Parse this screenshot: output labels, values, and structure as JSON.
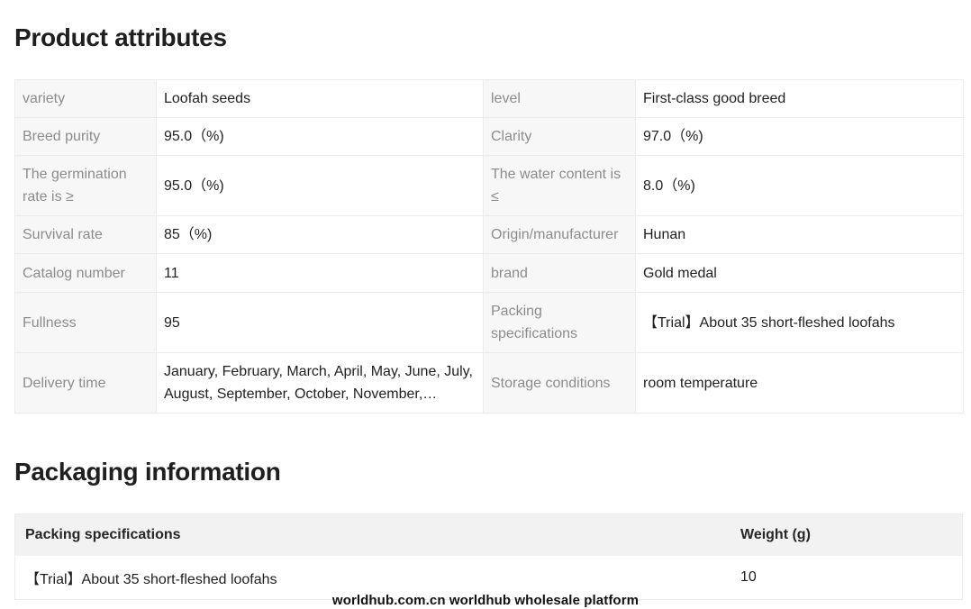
{
  "attributes": {
    "title": "Product attributes",
    "rows": [
      {
        "k1": "variety",
        "v1": "Loofah seeds",
        "k2": "level",
        "v2": "First-class good breed"
      },
      {
        "k1": "Breed purity",
        "v1": "95.0（%)",
        "k2": "Clarity",
        "v2": "97.0（%)"
      },
      {
        "k1": "The germination rate is ≥",
        "v1": "95.0（%)",
        "k2": "The water content is ≤",
        "v2": "8.0（%)"
      },
      {
        "k1": "Survival rate",
        "v1": "85（%)",
        "k2": "Origin/manufacturer",
        "v2": "Hunan"
      },
      {
        "k1": "Catalog number",
        "v1": "11",
        "k2": "brand",
        "v2": "Gold medal"
      },
      {
        "k1": "Fullness",
        "v1": "95",
        "k2": "Packing specifications",
        "v2": "【Trial】About 35 short-fleshed loofahs"
      },
      {
        "k1": "Delivery time",
        "v1": "January, February, March, April, May, June, July, August, September, October, November, December",
        "k2": "Storage conditions",
        "v2": "room temperature"
      }
    ]
  },
  "packaging": {
    "title": "Packaging information",
    "headers": {
      "spec": "Packing specifications",
      "weight": "Weight (g)"
    },
    "rows": [
      {
        "spec": "【Trial】About 35 short-fleshed loofahs",
        "weight": "10"
      }
    ]
  },
  "watermark": "worldhub.com.cn worldhub wholesale platform"
}
